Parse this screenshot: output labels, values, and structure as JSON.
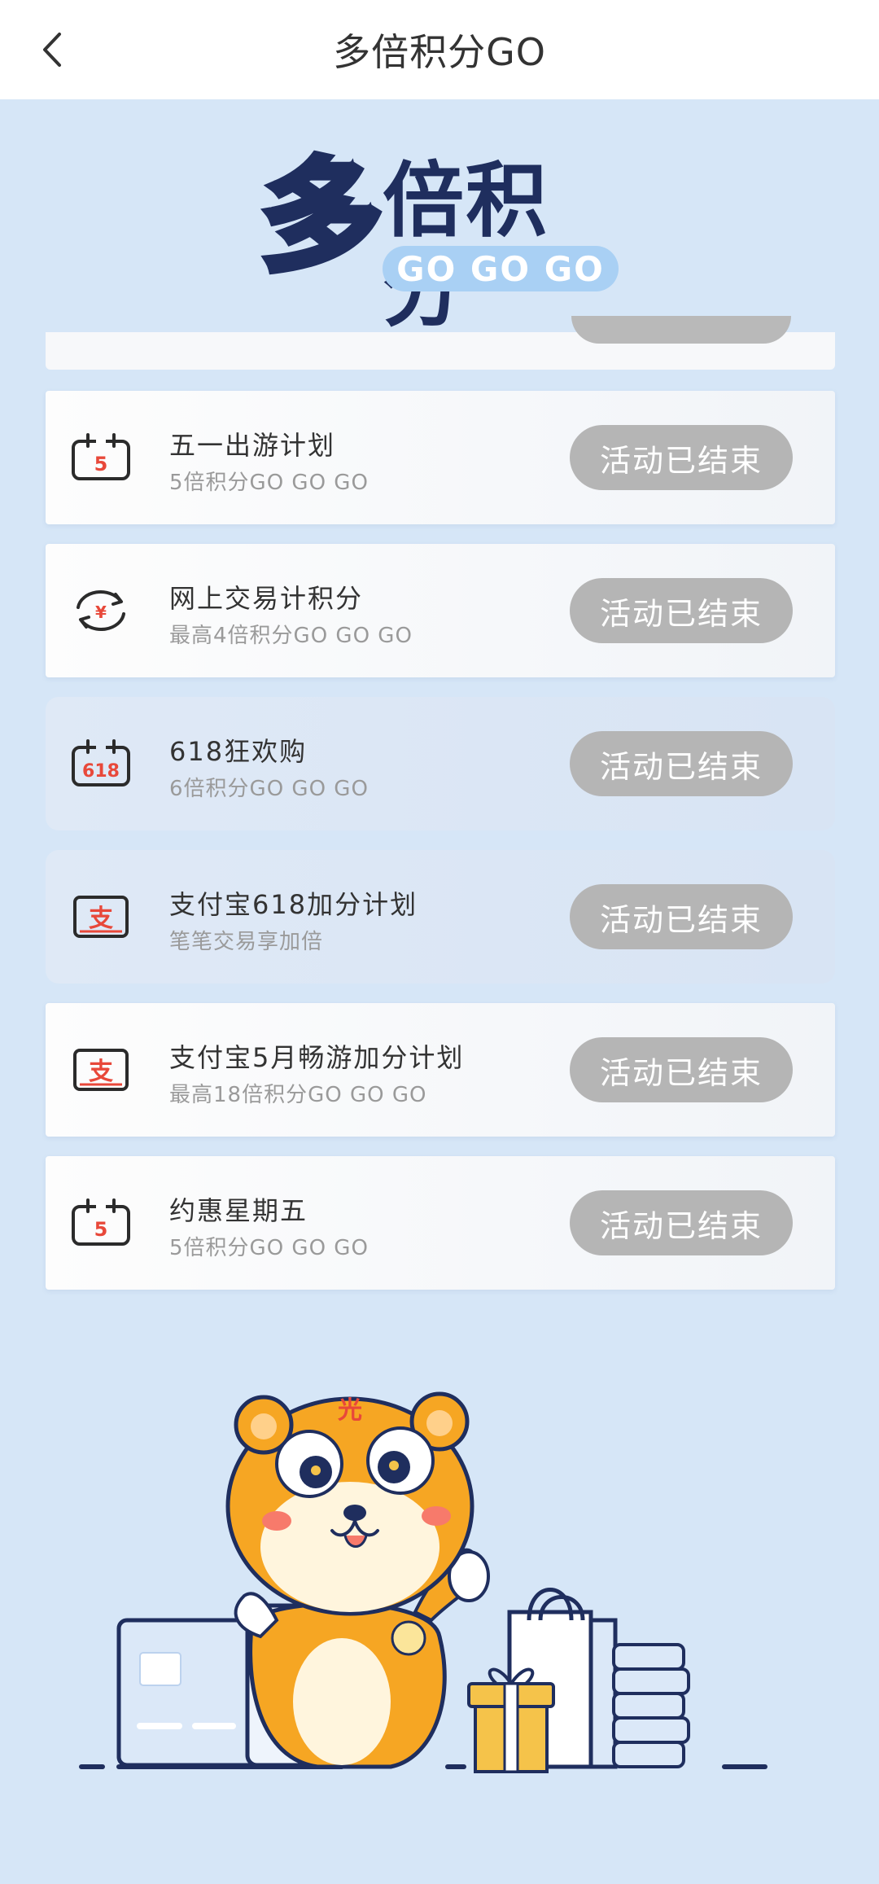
{
  "header": {
    "title": "多倍积分GO",
    "back_icon": "chevron-left-icon"
  },
  "banner": {
    "logo_char": "多",
    "logo_rest": "倍积分",
    "logo_tagline": "GO GO GO"
  },
  "activities": [
    {
      "icon": "calendar-5-icon",
      "title": "五一出游计划",
      "subtitle": "5倍积分GO GO GO",
      "status": "活动已结束"
    },
    {
      "icon": "yuan-exchange-icon",
      "title": "网上交易计积分",
      "subtitle": "最高4倍积分GO GO GO",
      "status": "活动已结束"
    },
    {
      "icon": "calendar-618-icon",
      "title": "618狂欢购",
      "subtitle": "6倍积分GO GO GO",
      "status": "活动已结束"
    },
    {
      "icon": "alipay-icon",
      "title": "支付宝618加分计划",
      "subtitle": "笔笔交易享加倍",
      "status": "活动已结束"
    },
    {
      "icon": "alipay-icon",
      "title": "支付宝5月畅游加分计划",
      "subtitle": "最高18倍积分GO GO GO",
      "status": "活动已结束"
    },
    {
      "icon": "calendar-5-icon",
      "title": "约惠星期五",
      "subtitle": "5倍积分GO GO GO",
      "status": "活动已结束"
    }
  ],
  "icon_labels": {
    "calendar_5": "5",
    "calendar_618": "618",
    "yuan": "¥",
    "alipay": "支"
  },
  "mascot": {
    "forehead_char": "光"
  },
  "colors": {
    "page_bg": "#d6e6f7",
    "accent_red": "#e8483a",
    "navy": "#1f2e5e",
    "ended_button": "#b5b5b5"
  }
}
